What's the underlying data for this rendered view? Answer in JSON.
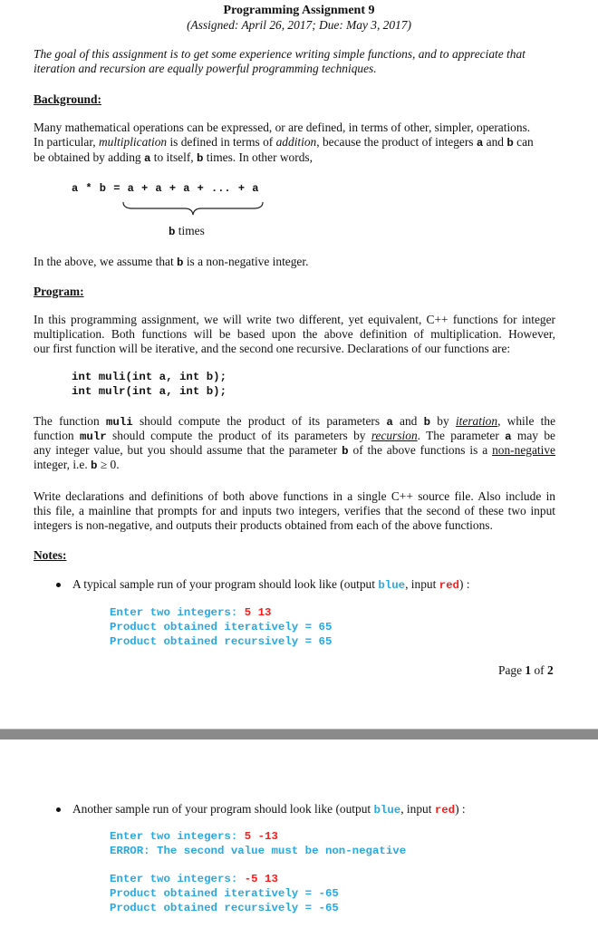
{
  "header": {
    "title": "Programming Assignment 9",
    "subtitle": "(Assigned: April 26, 2017; Due: May 3, 2017)"
  },
  "goal": {
    "line1": "The goal of this assignment is to get some experience writing simple functions, and to appreciate that",
    "line2": "iteration and recursion are equally powerful programming techniques."
  },
  "background": {
    "heading": "Background:",
    "p1": {
      "l1": "Many mathematical operations can be expressed, or are defined, in terms of other, simpler, operations.",
      "l2_a": "In particular, ",
      "l2_b": "multiplication",
      "l2_c": " is defined in terms of ",
      "l2_d": "addition",
      "l2_e": ", because the product of integers ",
      "l2_f": "a",
      "l2_g": " and ",
      "l2_h": "b",
      "l2_i": " can",
      "l3_a": "be obtained by adding ",
      "l3_b": "a",
      "l3_c": " to itself, ",
      "l3_d": "b",
      "l3_e": " times.  In other words,"
    },
    "formula": "a * b = a + a + a + ... + a",
    "brace_label_var": "b",
    "brace_label_text": " times",
    "p2_a": "In the above, we assume that ",
    "p2_b": "b",
    "p2_c": " is a non-negative integer."
  },
  "program": {
    "heading": "Program:",
    "p1": {
      "l1": "In this programming assignment, we will write two different, yet equivalent, C++ functions for integer",
      "l2": "multiplication.  Both functions will be based upon the above definition of multiplication.  However,",
      "l3": "our first function will be iterative, and the second one recursive.  Declarations of our functions are:"
    },
    "code": [
      "int muli(int a, int b);",
      "int mulr(int a, int b);"
    ],
    "p2": {
      "l1_a": "The function ",
      "l1_b": "muli",
      "l1_c": " should compute the product of its parameters ",
      "l1_d": "a",
      "l1_e": " and ",
      "l1_f": "b",
      "l1_g": " by ",
      "l1_h": "iteration",
      "l1_i": ", while the",
      "l2_a": "function ",
      "l2_b": "mulr",
      "l2_c": " should compute the product of its parameters by ",
      "l2_d": "recursion",
      "l2_e": ".  The parameter ",
      "l2_f": "a",
      "l2_g": " may be",
      "l3_a": "any integer value, but you should assume that the parameter ",
      "l3_b": "b",
      "l3_c": " of the above functions is a ",
      "l3_d": "non-negative",
      "l4_a": "integer, i.e. ",
      "l4_b": "b",
      "l4_c": " ≥ 0."
    },
    "p3": {
      "l1": "Write declarations and definitions of both above functions in a single C++ source file.  Also include in",
      "l2": "this file, a mainline that prompts for and inputs two integers, verifies that the second of these two input",
      "l3": "integers is non-negative, and outputs their products obtained from each of the above functions."
    }
  },
  "notes": {
    "heading": "Notes:",
    "items": [
      {
        "intro_a": "A typical sample run of your program should look like (output ",
        "intro_blue": "blue",
        "intro_b": ", input ",
        "intro_red": "red",
        "intro_c": ") :",
        "lines": [
          {
            "out": "Enter two integers: ",
            "in": "5 13"
          },
          {
            "out": "Product obtained iteratively = 65",
            "in": ""
          },
          {
            "out": "Product obtained recursively = 65",
            "in": ""
          }
        ]
      },
      {
        "intro_a": "Another sample run of your program should look like (output ",
        "intro_blue": "blue",
        "intro_b": ", input ",
        "intro_red": "red",
        "intro_c": ") :",
        "lines": [
          {
            "out": "Enter two integers: ",
            "in": "5 -13"
          },
          {
            "out": "ERROR: The second value must be non-negative",
            "in": ""
          },
          {
            "out": "Enter two integers: ",
            "in": "-5 13"
          },
          {
            "out": "Product obtained iteratively = -65",
            "in": ""
          },
          {
            "out": "Product obtained recursively = -65",
            "in": ""
          }
        ]
      }
    ]
  },
  "footer": {
    "page_prefix": "Page ",
    "page_current": "1",
    "page_mid": " of ",
    "page_total": "2"
  },
  "colors": {
    "output": "#29a8e0",
    "input": "#ff1a1a",
    "page_separator": "#8a8a8a"
  }
}
